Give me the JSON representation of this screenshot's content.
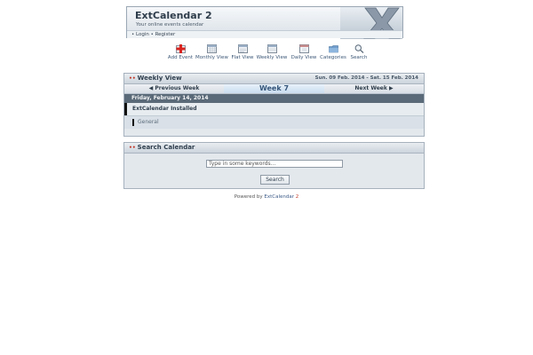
{
  "header": {
    "title": "ExtCalendar 2",
    "subtitle": "Your online events calendar",
    "login": "Login",
    "register": "Register",
    "bullet": "•"
  },
  "toolbar": [
    {
      "label": "Add Event",
      "icon": "add-event-icon"
    },
    {
      "label": "Monthly View",
      "icon": "monthly-view-icon"
    },
    {
      "label": "Flat View",
      "icon": "flat-view-icon"
    },
    {
      "label": "Weekly View",
      "icon": "weekly-view-icon"
    },
    {
      "label": "Daily View",
      "icon": "daily-view-icon"
    },
    {
      "label": "Categories",
      "icon": "categories-icon"
    },
    {
      "label": "Search",
      "icon": "search-icon"
    }
  ],
  "weekly": {
    "title": "Weekly View",
    "range": "Sun. 09 Feb. 2014 - Sat. 15 Feb. 2014",
    "prev": "Previous Week",
    "week": "Week 7",
    "next": "Next Week",
    "day": "Friday, February 14, 2014",
    "event": "ExtCalendar Installed",
    "category": "General"
  },
  "search": {
    "title": "Search Calendar",
    "placeholder": "Type in some keywords...",
    "button": "Search"
  },
  "footer": {
    "powered": "Powered by",
    "brand": "ExtCalendar",
    "version": "2"
  },
  "colors": {
    "accent": "#c23a2a",
    "link": "#3c5777",
    "dayheader": "#5b6a78"
  }
}
